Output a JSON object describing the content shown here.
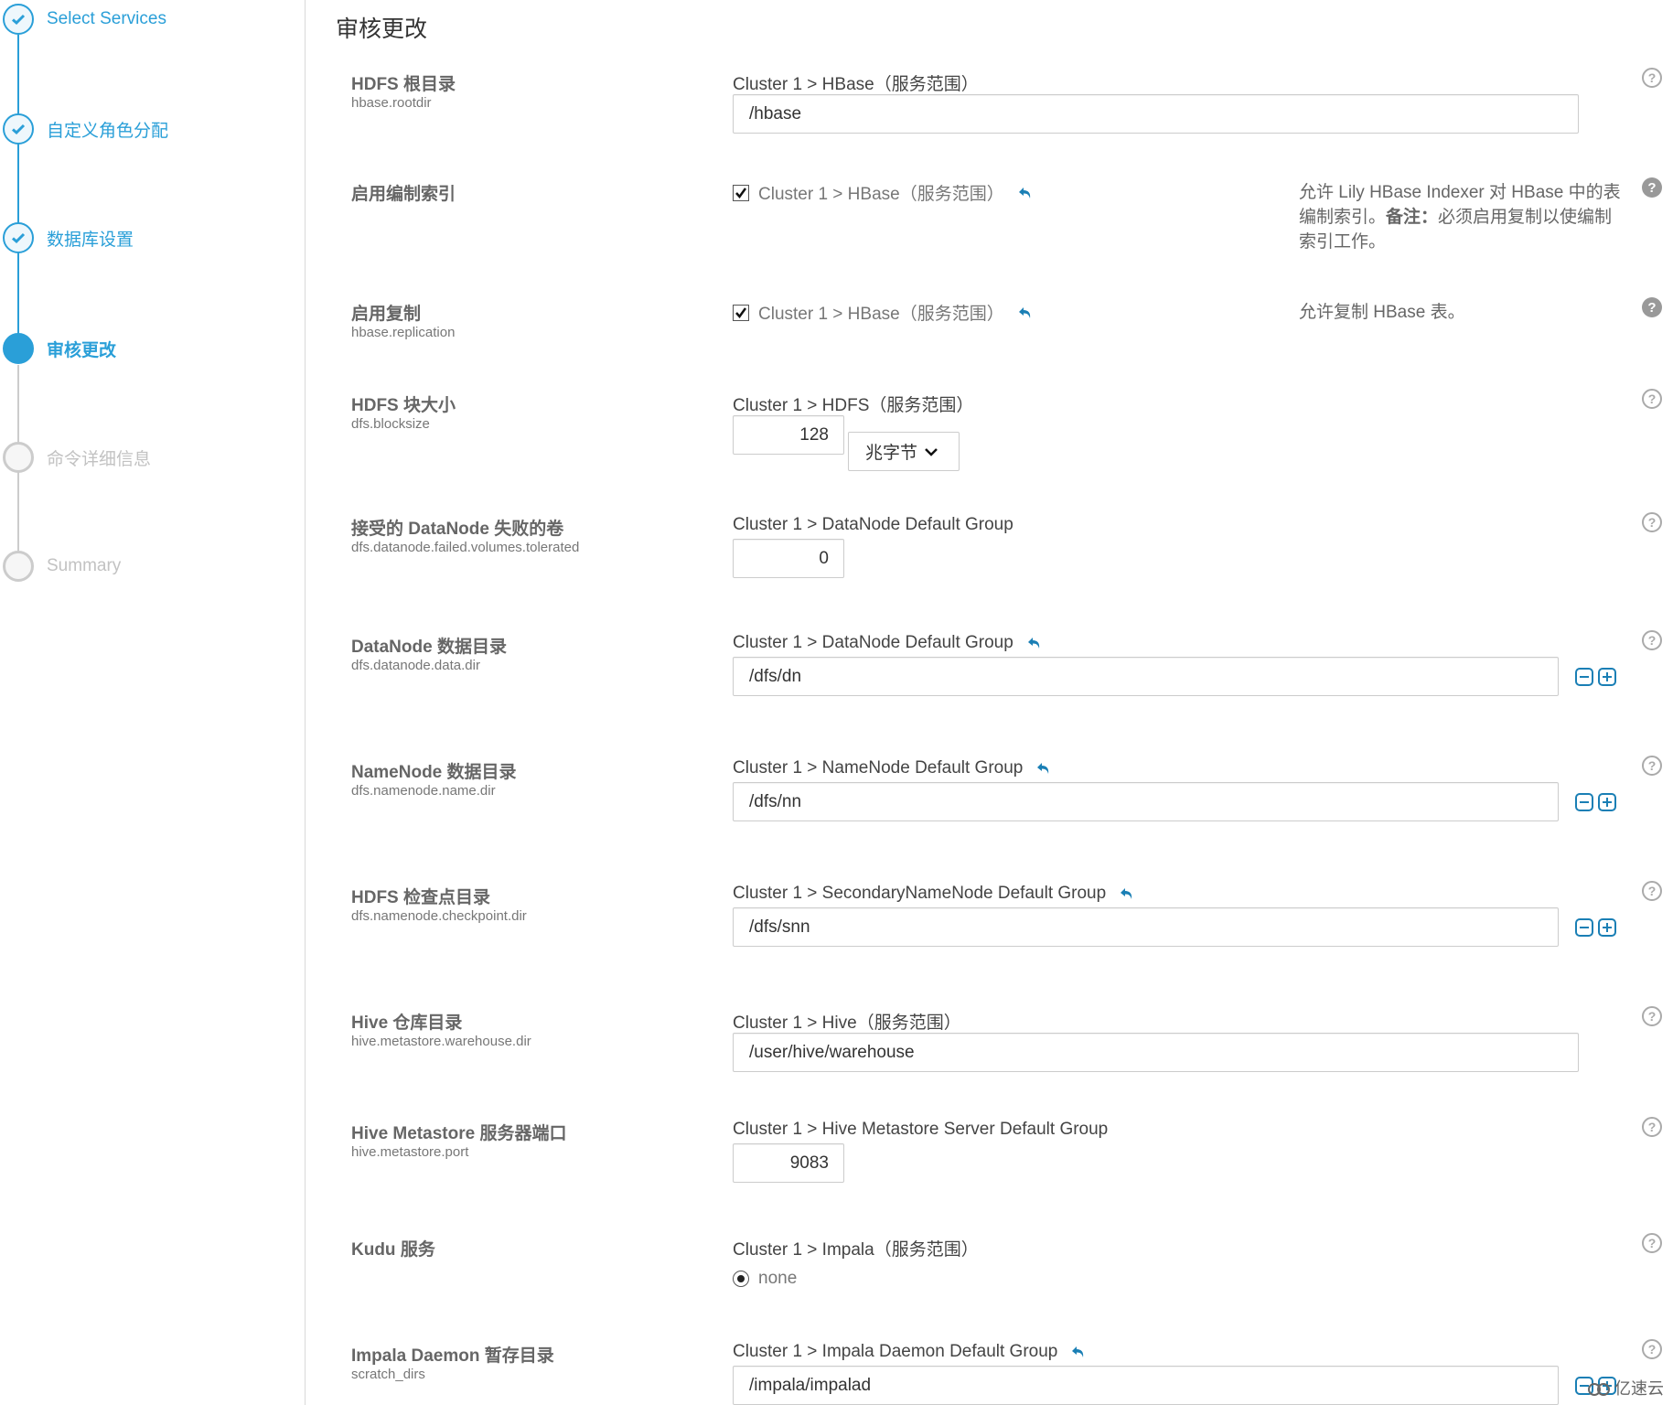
{
  "sidebar": {
    "steps": [
      {
        "label": "Select Services",
        "state": "done"
      },
      {
        "label": "自定义角色分配",
        "state": "done"
      },
      {
        "label": "数据库设置",
        "state": "done"
      },
      {
        "label": "审核更改",
        "state": "current"
      },
      {
        "label": "命令详细信息",
        "state": "pending"
      },
      {
        "label": "Summary",
        "state": "pending"
      }
    ]
  },
  "page": {
    "title": "审核更改"
  },
  "properties": [
    {
      "label": "HDFS 根目录",
      "key": "hbase.rootdir",
      "scope": "Cluster 1 > HBase（服务范围）",
      "value": "/hbase"
    },
    {
      "label": "启用编制索引",
      "key": "",
      "scope": "Cluster 1 > HBase（服务范围）",
      "checked": true,
      "description_pre": "允许 Lily HBase Indexer 对 HBase 中的表编制索引。",
      "description_bold": "备注：",
      "description_post": "必须启用复制以使编制索引工作。"
    },
    {
      "label": "启用复制",
      "key": "hbase.replication",
      "scope": "Cluster 1 > HBase（服务范围）",
      "checked": true,
      "description_pre": "允许复制 HBase 表。"
    },
    {
      "label": "HDFS 块大小",
      "key": "dfs.blocksize",
      "scope": "Cluster 1 > HDFS（服务范围）",
      "value": "128",
      "unit": "兆字节"
    },
    {
      "label": "接受的 DataNode 失败的卷",
      "key": "dfs.datanode.failed.volumes.tolerated",
      "scope": "Cluster 1 > DataNode Default Group",
      "value": "0"
    },
    {
      "label": "DataNode 数据目录",
      "key": "dfs.datanode.data.dir",
      "scope": "Cluster 1 > DataNode Default Group",
      "value": "/dfs/dn"
    },
    {
      "label": "NameNode 数据目录",
      "key": "dfs.namenode.name.dir",
      "scope": "Cluster 1 > NameNode Default Group",
      "value": "/dfs/nn"
    },
    {
      "label": "HDFS 检查点目录",
      "key": "dfs.namenode.checkpoint.dir",
      "scope": "Cluster 1 > SecondaryNameNode Default Group",
      "value": "/dfs/snn"
    },
    {
      "label": "Hive 仓库目录",
      "key": "hive.metastore.warehouse.dir",
      "scope": "Cluster 1 > Hive（服务范围）",
      "value": "/user/hive/warehouse"
    },
    {
      "label": "Hive Metastore 服务器端口",
      "key": "hive.metastore.port",
      "scope": "Cluster 1 > Hive Metastore Server Default Group",
      "value": "9083"
    },
    {
      "label": "Kudu 服务",
      "key": "",
      "scope": "Cluster 1 > Impala（服务范围）",
      "radio_option": "none",
      "radio_selected": true
    },
    {
      "label": "Impala Daemon 暂存目录",
      "key": "scratch_dirs",
      "scope": "Cluster 1 > Impala Daemon Default Group",
      "value": "/impala/impalad"
    }
  ],
  "watermark": "亿速云",
  "colors": {
    "accent": "#2a9fd8",
    "undo": "#1a7fb5",
    "help": "#999999"
  }
}
